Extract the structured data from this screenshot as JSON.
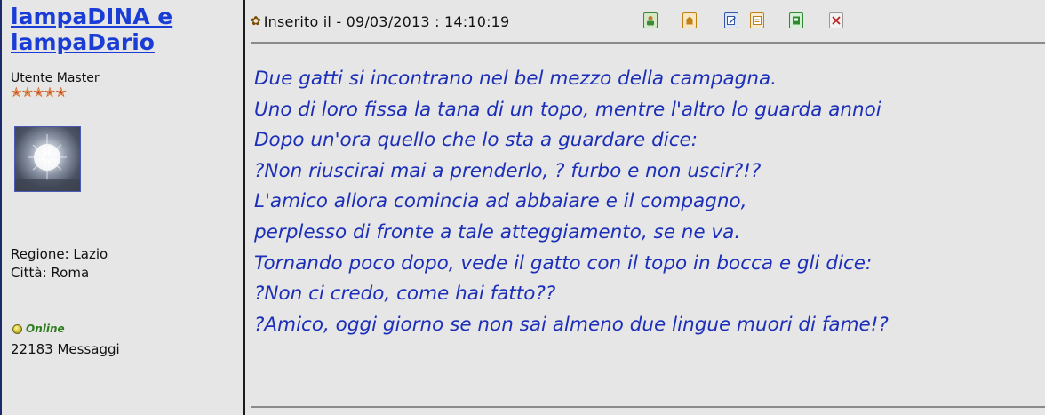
{
  "author": {
    "name": "lampaDINA e lampaDario",
    "rank": "Utente Master",
    "stars": 5,
    "region": "Regione: Lazio",
    "city": "Città: Roma",
    "status": "Online",
    "posts": "22183 Messaggi"
  },
  "post": {
    "posted": "Inserito il - 09/03/2013 : 14:10:19",
    "toolbar": [
      {
        "name": "profile-icon",
        "color": "#3a8a3a"
      },
      {
        "name": "home-icon",
        "color": "#c0801a"
      },
      {
        "name": "edit-icon",
        "color": "#3355aa"
      },
      {
        "name": "quote-icon",
        "color": "#c0801a"
      },
      {
        "name": "ip-icon",
        "color": "#2e8a2e"
      },
      {
        "name": "delete-icon",
        "color": "#c02020"
      }
    ],
    "lines": [
      "Due gatti si incontrano nel bel mezzo della campagna.",
      "Uno di loro fissa la tana di un topo, mentre l'altro lo guarda annoi",
      "Dopo un'ora quello che lo sta a guardare dice:",
      "?Non riuscirai mai a prenderlo, ? furbo e non uscir?!?",
      "L'amico allora comincia ad abbaiare e il compagno,",
      "perplesso di fronte a tale atteggiamento, se ne va.",
      "Tornando poco dopo, vede il gatto con il topo in bocca e gli dice:",
      "?Non ci credo, come hai fatto??",
      "?Amico, oggi giorno se non sai almeno due lingue muori di fame!?"
    ]
  },
  "colors": {
    "link": "#1a3dd6",
    "message": "#1c2fb8",
    "star": "#c73a1e",
    "online": "#2e7d1f"
  }
}
